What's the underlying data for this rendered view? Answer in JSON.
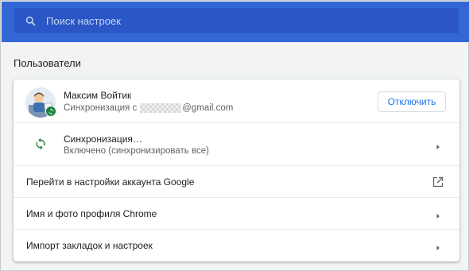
{
  "search": {
    "placeholder": "Поиск настроек",
    "icon": "search-icon"
  },
  "section": {
    "title": "Пользователи"
  },
  "account": {
    "name": "Максим Войтик",
    "sync_prefix": "Синхронизация с",
    "email_suffix": "@gmail.com",
    "signout_label": "Отключить"
  },
  "sync": {
    "title": "Синхронизация…",
    "status": "Включено (синхронизировать все)"
  },
  "items": [
    {
      "label": "Перейти в настройки аккаунта Google",
      "icon": "open-in-new-icon"
    },
    {
      "label": "Имя и фото профиля Chrome",
      "icon": "chevron-right-icon"
    },
    {
      "label": "Импорт закладок и настроек",
      "icon": "chevron-right-icon"
    }
  ],
  "colors": {
    "header": "#3367d6",
    "search_bg": "#2a56c6",
    "accent": "#1a73e8",
    "sync_green": "#188038"
  }
}
